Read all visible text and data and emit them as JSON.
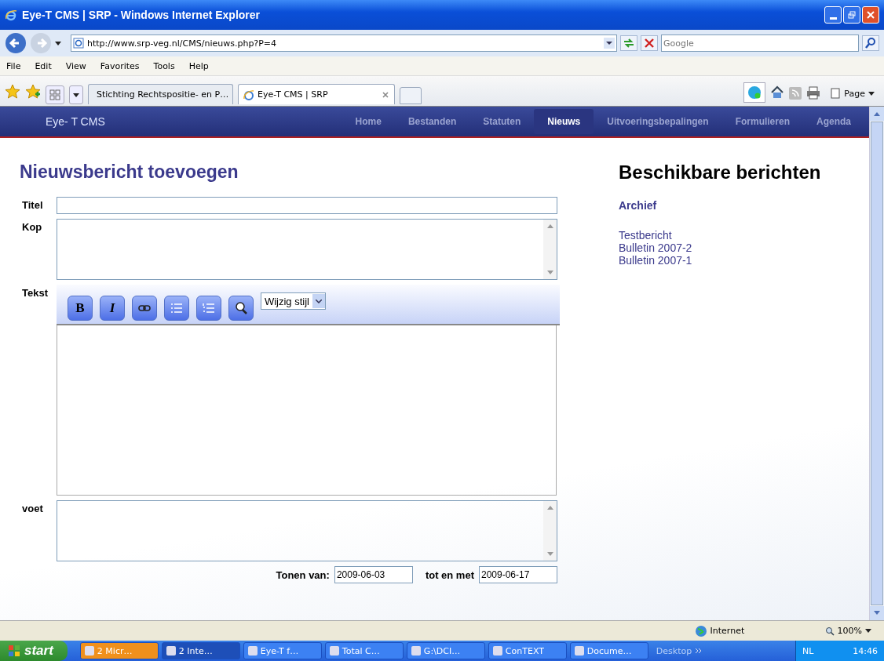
{
  "window": {
    "title": "Eye-T CMS | SRP - Windows Internet Explorer"
  },
  "address": {
    "url": "http://www.srp-veg.nl/CMS/nieuws.php?P=4"
  },
  "search": {
    "placeholder": "Google"
  },
  "menu": [
    "File",
    "Edit",
    "View",
    "Favorites",
    "Tools",
    "Help"
  ],
  "tabs": [
    {
      "label": "Stichting Rechtspositie- en P…",
      "selected": false
    },
    {
      "label": "Eye-T CMS | SRP",
      "selected": true
    }
  ],
  "command_bar": {
    "page": "Page"
  },
  "site": {
    "brand": "Eye- T CMS",
    "nav": [
      {
        "label": "Home",
        "selected": false
      },
      {
        "label": "Bestanden",
        "selected": false
      },
      {
        "label": "Statuten",
        "selected": false
      },
      {
        "label": "Nieuws",
        "selected": true
      },
      {
        "label": "Uitvoeringsbepalingen",
        "selected": false
      },
      {
        "label": "Formulieren",
        "selected": false
      },
      {
        "label": "Agenda",
        "selected": false
      }
    ]
  },
  "form": {
    "heading": "Nieuwsbericht toevoegen",
    "fields": [
      {
        "label": "Titel",
        "kind": "line"
      },
      {
        "label": "Kop",
        "kind": "area"
      },
      {
        "label": "Tekst",
        "kind": "editor"
      },
      {
        "label": "voet",
        "kind": "area"
      }
    ],
    "toolbar": [
      {
        "kind": "bold",
        "label": "B"
      },
      {
        "kind": "italic",
        "label": "I"
      },
      {
        "kind": "link"
      },
      {
        "kind": "bullets"
      },
      {
        "kind": "numbers"
      },
      {
        "kind": "source"
      }
    ],
    "style_select": "Wijzig stijl",
    "from_label": "Tonen van:",
    "from_value": "2009-06-03",
    "to_label": "tot en met",
    "to_value": "2009-06-17"
  },
  "sidebar": {
    "heading": "Beschikbare berichten",
    "archive": "Archief",
    "items": [
      "Testbericht",
      "Bulletin 2007-2",
      "Bulletin 2007-1"
    ]
  },
  "status_bar": {
    "zone": "Internet",
    "zoom": "100%"
  },
  "taskbar": {
    "start": "start",
    "items": [
      {
        "label": "2 Micr…",
        "kind": "clock"
      },
      {
        "label": "2 Inte…",
        "kind": "ie"
      },
      {
        "label": "Eye-T f…",
        "kind": "excel"
      },
      {
        "label": "Total C…",
        "kind": "disk"
      },
      {
        "label": "G:\\DCI…",
        "kind": "folder"
      },
      {
        "label": "ConTEXT",
        "kind": "context"
      },
      {
        "label": "Docume…",
        "kind": "word"
      }
    ],
    "desktop": "Desktop",
    "language": "NL",
    "clock": "14:46"
  }
}
